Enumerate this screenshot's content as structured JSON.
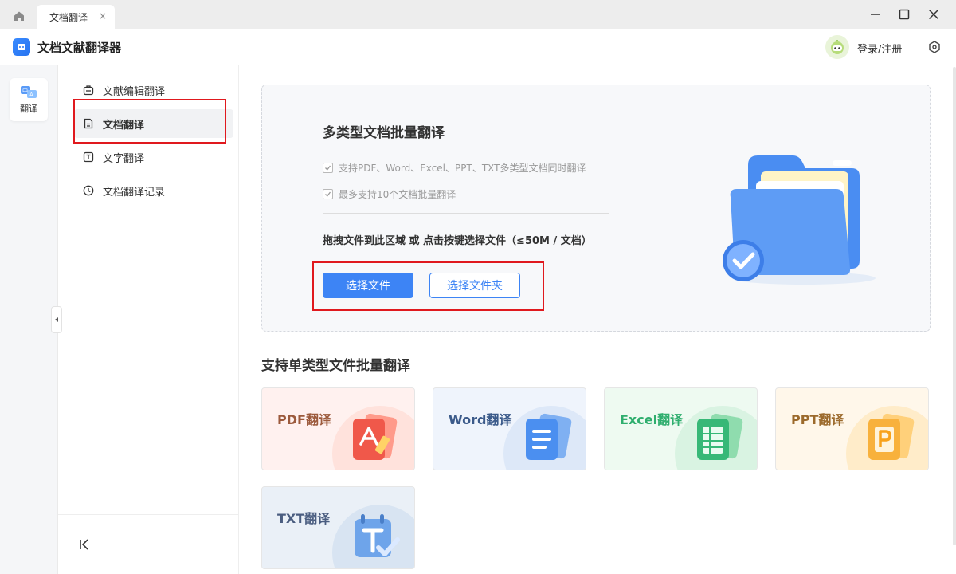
{
  "tabbar": {
    "tab_title": "文档翻译",
    "tab_close": "×"
  },
  "app": {
    "title": "文档文献翻译器",
    "login_label": "登录/注册"
  },
  "rail": {
    "items": [
      {
        "label": "翻译"
      }
    ]
  },
  "subnav": {
    "items": [
      {
        "label": "文献编辑翻译",
        "icon": "briefcase-icon"
      },
      {
        "label": "文档翻译",
        "icon": "document-icon",
        "active": true
      },
      {
        "label": "文字翻译",
        "icon": "text-icon"
      },
      {
        "label": "文档翻译记录",
        "icon": "clock-icon"
      }
    ]
  },
  "dropzone": {
    "title": "多类型文档批量翻译",
    "features": [
      "支持PDF、Word、Excel、PPT、TXT多类型文档同时翻译",
      "最多支持10个文档批量翻译"
    ],
    "hint": "拖拽文件到此区域 或 点击按键选择文件（≤50M / 文档）",
    "select_file": "选择文件",
    "select_folder": "选择文件夹"
  },
  "section": {
    "title": "支持单类型文件批量翻译"
  },
  "cards": [
    {
      "label": "PDF翻译",
      "color": "#9c5a3c"
    },
    {
      "label": "Word翻译",
      "color": "#3b5a8a"
    },
    {
      "label": "Excel翻译",
      "color": "#2fae6e"
    },
    {
      "label": "PPT翻译",
      "color": "#9c6a2c"
    },
    {
      "label": "TXT翻译",
      "color": "#4a5d80"
    }
  ],
  "colors": {
    "accent": "#3d84f5",
    "highlight": "#e0191e"
  }
}
